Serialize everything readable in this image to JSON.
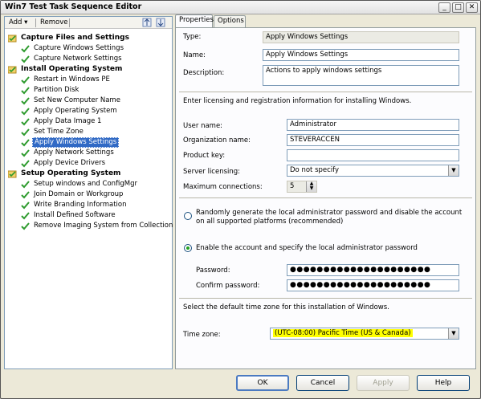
{
  "window": {
    "title": "Win7 Test Task Sequence Editor"
  },
  "titlebar_buttons": {
    "minimize": "_",
    "maximize": "□",
    "close": "✕"
  },
  "toolbar": {
    "add_label": "Add",
    "remove_label": "Remove"
  },
  "tree": {
    "groups": [
      {
        "label": "Capture Files and Settings",
        "items": [
          "Capture Windows Settings",
          "Capture Network Settings"
        ]
      },
      {
        "label": "Install Operating System",
        "items": [
          "Restart in Windows PE",
          "Partition Disk",
          "Set New Computer Name",
          "Apply Operating System",
          "Apply Data Image 1",
          "Set Time Zone",
          "Apply Windows Settings",
          "Apply Network Settings",
          "Apply Device Drivers"
        ]
      },
      {
        "label": "Setup Operating System",
        "items": [
          "Setup windows and ConfigMgr",
          "Join Domain or Workgroup",
          "Write Branding Information",
          "Install Defined Software",
          "Remove Imaging System from Collection"
        ]
      }
    ],
    "selected": "Apply Windows Settings"
  },
  "tabs": {
    "properties": "Properties",
    "options": "Options"
  },
  "form": {
    "type_label": "Type:",
    "type_value": "Apply Windows Settings",
    "name_label": "Name:",
    "name_value": "Apply Windows Settings",
    "description_label": "Description:",
    "description_value": "Actions to apply windows settings",
    "licensing_text": "Enter licensing and registration information for installing Windows.",
    "username_label": "User name:",
    "username_value": "Administrator",
    "org_label": "Organization name:",
    "org_value": "STEVERACCEN",
    "productkey_label": "Product key:",
    "productkey_value": "",
    "server_licensing_label": "Server licensing:",
    "server_licensing_value": "Do not specify",
    "max_connections_label": "Maximum connections:",
    "max_connections_value": "5",
    "radio_random_label": "Randomly generate the local administrator password and disable the account on all supported platforms (recommended)",
    "radio_enable_label": "Enable the account and specify the local administrator password",
    "password_label": "Password:",
    "password_value": "●●●●●●●●●●●●●●●●●●●●●",
    "confirm_label": "Confirm password:",
    "confirm_value": "●●●●●●●●●●●●●●●●●●●●●",
    "timezone_text": "Select the default time zone for this installation of Windows.",
    "timezone_label": "Time zone:",
    "timezone_value": "(UTC-08:00) Pacific Time (US & Canada)"
  },
  "buttons": {
    "ok": "OK",
    "cancel": "Cancel",
    "apply": "Apply",
    "help": "Help"
  },
  "colors": {
    "selection": "#316ac5",
    "highlight": "#ffff00",
    "check_green": "#2e9b2e"
  }
}
